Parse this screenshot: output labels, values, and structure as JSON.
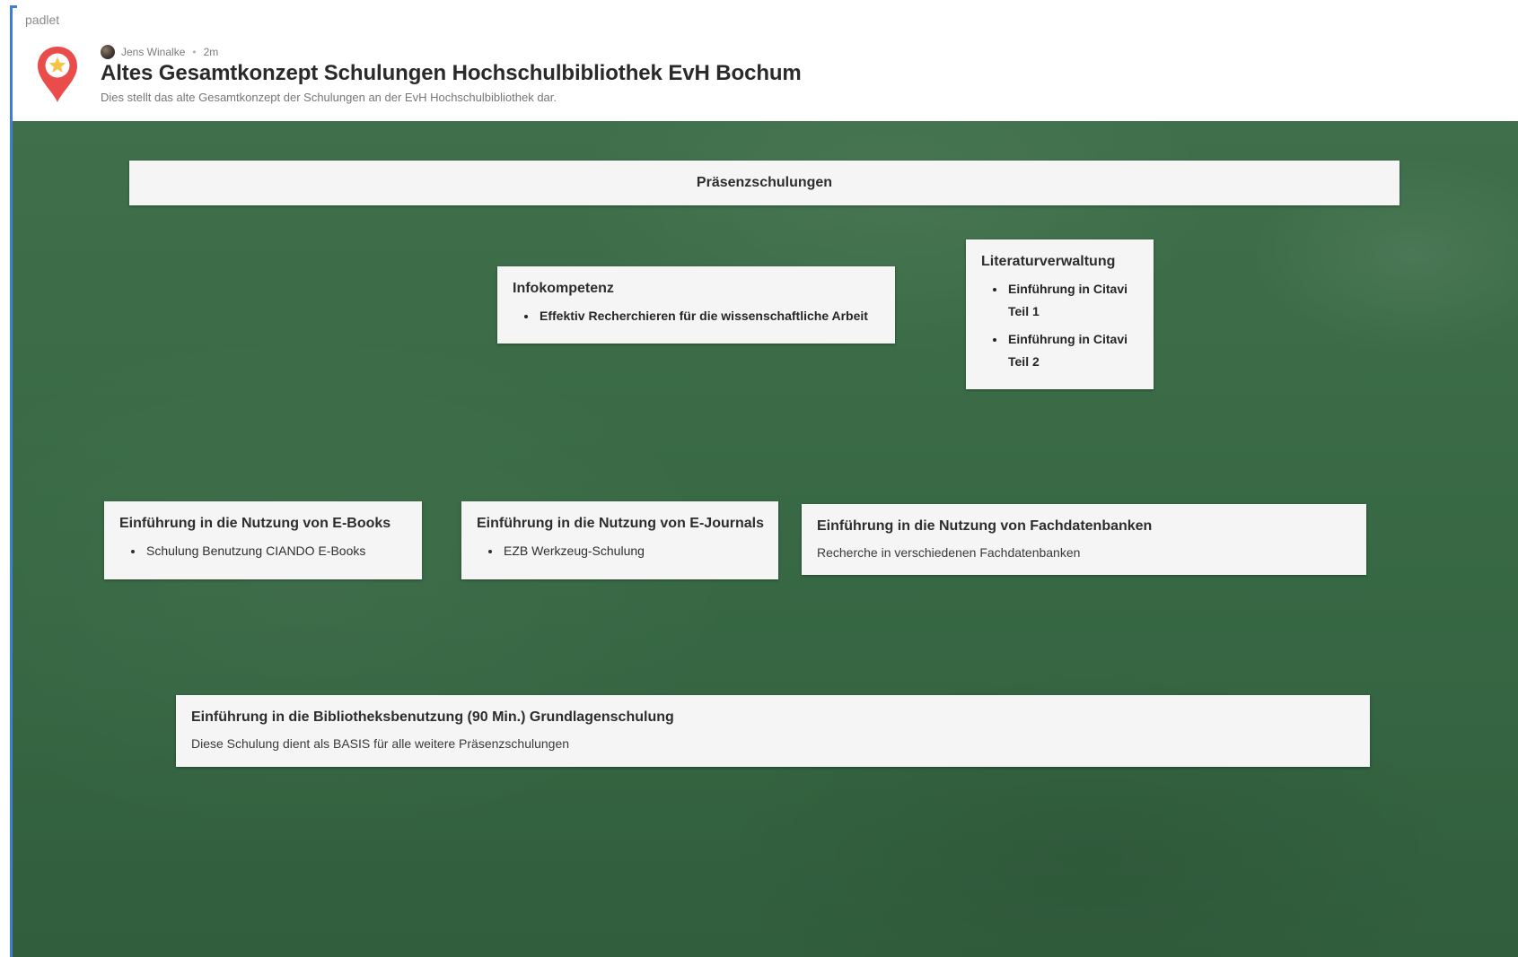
{
  "app": {
    "brand": "padlet"
  },
  "header": {
    "author": "Jens Winalke",
    "separator": "•",
    "time": "2m",
    "title": "Altes Gesamtkonzept Schulungen Hochschulbibliothek EvH Bochum",
    "description": "Dies stellt das alte Gesamtkonzept der Schulungen an der EvH Hochschulbibliothek dar.",
    "icon": "location-pin-star-icon"
  },
  "colors": {
    "board_green": "#3a6b46",
    "card_background": "#f5f5f5",
    "pin_red": "#ea4b4b",
    "pin_star": "#f6c343",
    "edge_blue": "#3d7fd6"
  },
  "cards": {
    "heading": {
      "title": "Präsenzschulungen"
    },
    "infokompetenz": {
      "title": "Infokompetenz",
      "items": [
        "Effektiv Recherchieren für die wissenschaftliche Arbeit"
      ]
    },
    "literatur": {
      "title": "Literaturverwaltung",
      "items": [
        "Einführung in Citavi Teil 1",
        "Einführung in Citavi Teil 2"
      ]
    },
    "ebooks": {
      "title": "Einführung in die Nutzung von E-Books",
      "items": [
        "Schulung Benutzung CIANDO E-Books"
      ]
    },
    "ejournals": {
      "title": "Einführung in die Nutzung von E-Journals",
      "items": [
        "EZB Werkzeug-Schulung"
      ]
    },
    "fachdatenbanken": {
      "title": "Einführung in die Nutzung von Fachdatenbanken",
      "body": "Recherche in verschiedenen Fachdatenbanken"
    },
    "grundlagen": {
      "title": "Einführung in die Bibliotheksbenutzung (90 Min.) Grundlagenschulung",
      "body": "Diese Schulung dient als BASIS für alle weitere Präsenzschulungen"
    }
  }
}
